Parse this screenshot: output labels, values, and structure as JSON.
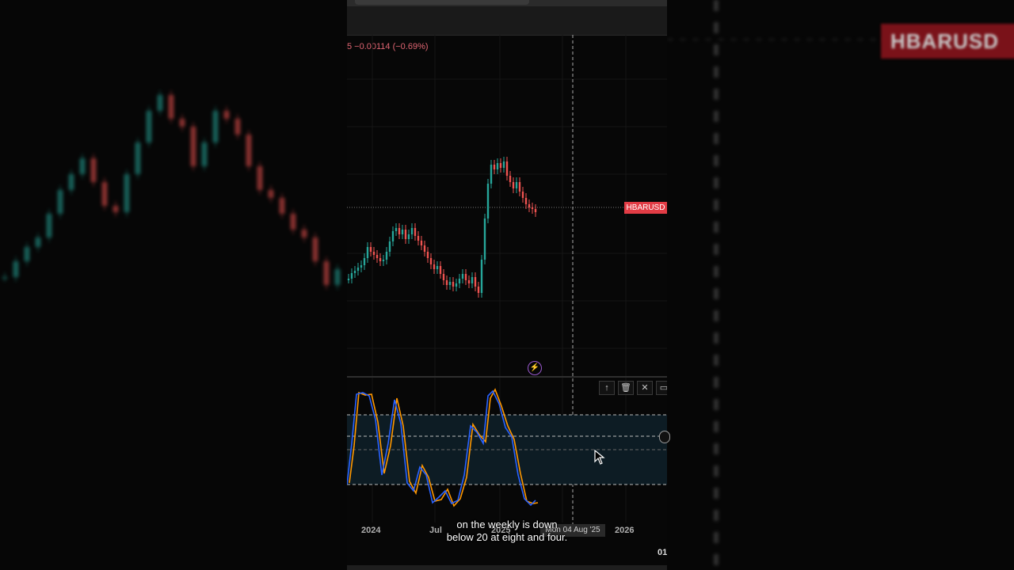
{
  "background": {
    "ticker_text": "HBARUSD"
  },
  "chart": {
    "price_change": "5 −0.00114 (−0.69%)",
    "ticker_tag": "HBARUSD",
    "x_axis": {
      "labels": [
        "2024",
        "Jul",
        "2025",
        "2026"
      ],
      "crosshair_date": "Mon 04 Aug '25"
    },
    "bottom_value": "01"
  },
  "toolbar": {
    "up_icon": "↑",
    "trash_icon": "🗑",
    "close_icon": "✕",
    "maximize_icon": "▭"
  },
  "indicator": {
    "bolt_icon": "⚡"
  },
  "caption": {
    "line1": "on the weekly is down",
    "line2": "below 20 at eight and four."
  },
  "colors": {
    "up": "#26a69a",
    "down": "#ef5350",
    "stoch_k": "#2962ff",
    "stoch_d": "#ff9800",
    "tag": "#e23c45"
  }
}
